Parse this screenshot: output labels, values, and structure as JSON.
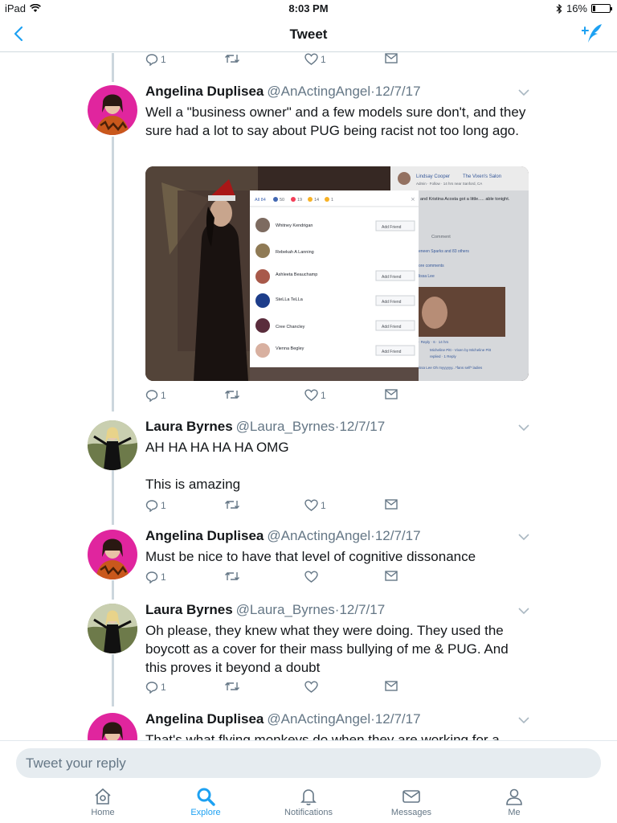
{
  "status_bar": {
    "device": "iPad",
    "time": "8:03 PM",
    "battery": "16%",
    "battery_level": 0.16
  },
  "nav": {
    "title": "Tweet",
    "back_icon": "chevron-left-icon",
    "compose_icon": "compose-tweet-icon"
  },
  "colors": {
    "accent": "#1da1f2",
    "muted": "#657786",
    "divider": "#e1e8ed"
  },
  "top_actions": {
    "replies": "1",
    "likes": "1"
  },
  "tweets": [
    {
      "name": "Angelina Duplisea",
      "handle": "@AnActingAngel",
      "date": "·12/7/17",
      "text": "Well a \"business owner\" and a few models sure don't, and they sure had a lot to say about PUG being racist not too long ago.",
      "replies": "1",
      "likes": "1",
      "media": {
        "post_author": "Lindsay Cooper",
        "post_group": "The Vixen's Salon",
        "post_meta": "Admin · Follow · 14 hrs near Sanford, CA",
        "post_text": "and Kristina Acosta got a little..... able tonight.",
        "comment_label": "Comment",
        "likes_line": "eneen Sparks and 83 others",
        "more_comments": "ore comments",
        "commenter": "lissa Lee",
        "reply_meta": "· Reply · 6 · 14 hrs",
        "reply_by": "Micheline Pitt - Vixen by Micheline Pitt",
        "reply_sub": "replied · 1 Reply",
        "last_comment": "issa Lee  Oh myyyyyy...*fans self* ladies",
        "reaction_summary": {
          "all": "All 84",
          "like": "50",
          "love": "19",
          "haha": "14",
          "wow": "1"
        },
        "reaction_users": [
          {
            "name": "Whitney Kendrigan",
            "button": "Add Friend"
          },
          {
            "name": "Rebekah A Lanning",
            "button": ""
          },
          {
            "name": "Ashleeta Beauchamp",
            "button": "Add Friend"
          },
          {
            "name": "SteLLa TeLLa",
            "button": "Add Friend"
          },
          {
            "name": "Cree Chancley",
            "button": "Add Friend"
          },
          {
            "name": "Vienna Begley",
            "button": "Add Friend"
          }
        ]
      }
    },
    {
      "name": "Laura Byrnes",
      "handle": "@Laura_Byrnes",
      "date": "·12/7/17",
      "text_line1": "AH HA HA HA HA OMG",
      "text_line2": "This is amazing",
      "replies": "1",
      "likes": "1"
    },
    {
      "name": "Angelina Duplisea",
      "handle": "@AnActingAngel",
      "date": "·12/7/17",
      "text": "Must be nice to have that level of cognitive dissonance",
      "replies": "1",
      "likes": ""
    },
    {
      "name": "Laura Byrnes",
      "handle": "@Laura_Byrnes",
      "date": "·12/7/17",
      "text": "Oh please, they knew what they were doing. They used the boycott as a cover for their mass bullying of me & PUG. And this proves it beyond a doubt",
      "replies": "1",
      "likes": ""
    },
    {
      "name": "Angelina Duplisea",
      "handle": "@AnActingAngel",
      "date": "·12/7/17",
      "text": "That's what flying monkeys do when they are working for a"
    }
  ],
  "reply": {
    "placeholder": "Tweet your reply"
  },
  "tabs": [
    {
      "label": "Home",
      "icon": "home-icon"
    },
    {
      "label": "Explore",
      "icon": "search-icon"
    },
    {
      "label": "Notifications",
      "icon": "bell-icon"
    },
    {
      "label": "Messages",
      "icon": "envelope-icon"
    },
    {
      "label": "Me",
      "icon": "person-icon"
    }
  ]
}
